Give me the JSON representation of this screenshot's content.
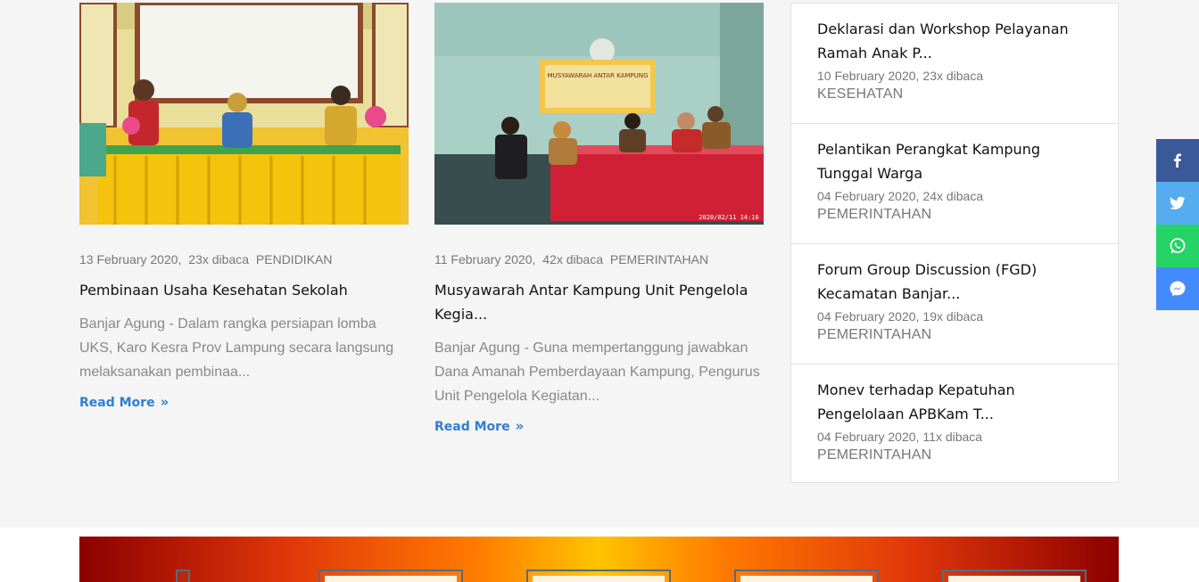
{
  "articles": [
    {
      "date": "13 February 2020,",
      "views": "23x dibaca",
      "category": "PENDIDIKAN",
      "title": "Pembinaan Usaha Kesehatan Sekolah",
      "excerpt": "Banjar Agung - Dalam rangka persiapan lomba UKS, Karo Kesra Prov Lampung secara langsung melaksanakan pembinaa...",
      "read_more": "Read More"
    },
    {
      "date": "11 February 2020,",
      "views": "42x dibaca",
      "category": "PEMERINTAHAN",
      "title": "Musyawarah Antar Kampung Unit Pengelola Kegia...",
      "excerpt": "Banjar Agung - Guna mempertanggung jawabkan Dana Amanah Pemberdayaan Kampung, Pengurus Unit Pengelola Kegiatan...",
      "read_more": "Read More",
      "photo_banner": "MUSYAWARAH ANTAR KAMPUNG",
      "photo_timestamp": "2020/02/11 14:16"
    }
  ],
  "sidebar": {
    "items": [
      {
        "title": "Deklarasi dan Workshop Pelayanan Ramah Anak P...",
        "date": "10 February 2020,",
        "views": "23x dibaca",
        "category": "KESEHATAN"
      },
      {
        "title": "Pelantikan Perangkat Kampung Tunggal Warga",
        "date": "04 February 2020,",
        "views": "24x dibaca",
        "category": "PEMERINTAHAN"
      },
      {
        "title": "Forum Group Discussion (FGD) Kecamatan Banjar...",
        "date": "04 February 2020,",
        "views": "19x dibaca",
        "category": "PEMERINTAHAN"
      },
      {
        "title": "Monev terhadap Kepatuhan Pengelolaan APBKam T...",
        "date": "04 February 2020,",
        "views": "11x dibaca",
        "category": "PEMERINTAHAN"
      }
    ]
  },
  "share": {
    "facebook_icon": "facebook-icon",
    "twitter_icon": "twitter-icon",
    "whatsapp_icon": "whatsapp-icon",
    "messenger_icon": "messenger-icon",
    "colors": {
      "facebook": "#3b5998",
      "twitter": "#55acee",
      "whatsapp": "#25d366",
      "messenger": "#448aff"
    }
  },
  "colors": {
    "accent": "#2f7ed1"
  }
}
